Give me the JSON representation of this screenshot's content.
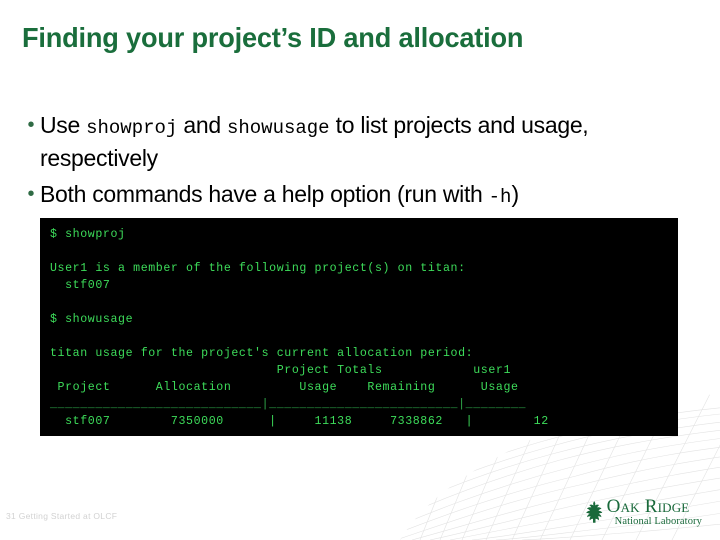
{
  "slide": {
    "title": "Finding your project’s ID and allocation",
    "accent_green": "#1a6e3c",
    "terminal_green": "#3ddc5a",
    "terminal_bg": "#000000"
  },
  "bullets": [
    {
      "marker": "•",
      "segments": [
        {
          "text": "Use ",
          "mono": false
        },
        {
          "text": "showproj",
          "mono": true
        },
        {
          "text": " and ",
          "mono": false
        },
        {
          "text": "showusage",
          "mono": true
        },
        {
          "text": " to list projects and usage, respectively",
          "mono": false
        }
      ]
    },
    {
      "marker": "•",
      "segments": [
        {
          "text": "Both commands have a help option (run with ",
          "mono": false
        },
        {
          "text": "-h",
          "mono": true
        },
        {
          "text": ")",
          "mono": false
        }
      ]
    }
  ],
  "terminal": {
    "lines": [
      "$ showproj",
      "",
      "User1 is a member of the following project(s) on titan:",
      "  stf007",
      "",
      "$ showusage",
      "",
      "titan usage for the project's current allocation period:",
      "                              Project Totals            user1",
      " Project      Allocation         Usage    Remaining      Usage",
      "____________________________|_________________________|________",
      "  stf007        7350000      |     11138     7338862   |        12"
    ]
  },
  "footer": {
    "page_number": "31",
    "text": "Getting Started at OLCF",
    "full": "31  Getting Started at OLCF"
  },
  "logo": {
    "name": "Oak Ridge",
    "subtitle": "National Laboratory",
    "icon": "oak-leaf-icon",
    "color": "#18693a"
  }
}
